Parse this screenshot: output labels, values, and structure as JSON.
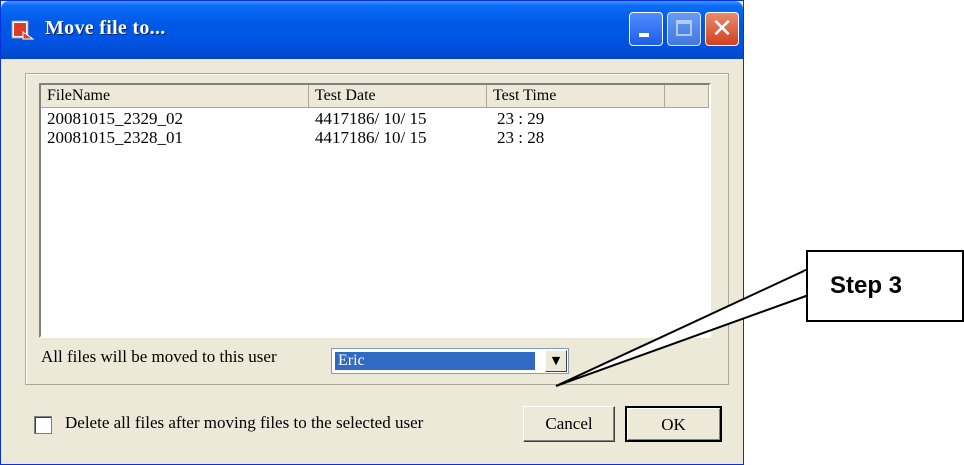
{
  "window": {
    "title": "Move file to..."
  },
  "list": {
    "columns": [
      "FileName",
      "Test Date",
      "Test Time",
      ""
    ],
    "rows": [
      {
        "filename": "20081015_2329_02",
        "date": "4417186/ 10/ 15",
        "time": "23 : 29"
      },
      {
        "filename": "20081015_2328_01",
        "date": "4417186/ 10/ 15",
        "time": "23 : 28"
      }
    ]
  },
  "user_select": {
    "label": "All files will be moved to this user",
    "value": "Eric"
  },
  "delete_option": {
    "label": "Delete all files after moving files to the selected user",
    "checked": false
  },
  "buttons": {
    "cancel": "Cancel",
    "ok": "OK"
  },
  "callout": {
    "text": "Step 3"
  },
  "colors": {
    "titlebar": "#0054e3",
    "selection": "#316ac5",
    "close": "#d2401f",
    "dialog_bg": "#ece9d8"
  },
  "icons": {
    "app": "move-file-app-icon",
    "minimize": "minimize-icon",
    "maximize": "maximize-icon",
    "close": "close-icon",
    "dropdown": "chevron-down-icon"
  }
}
